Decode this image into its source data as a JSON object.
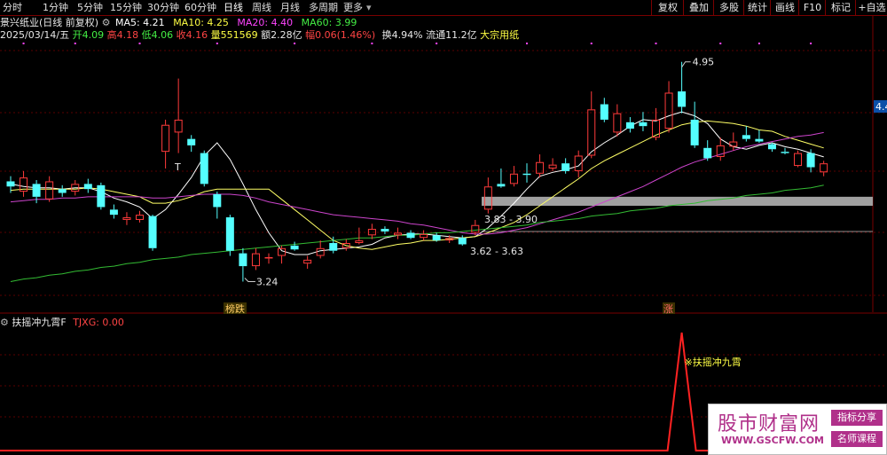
{
  "toolbar": {
    "periods": [
      "分时",
      "1分钟",
      "5分钟",
      "15分钟",
      "30分钟",
      "60分钟",
      "日线",
      "周线",
      "月线",
      "多周期",
      "更多"
    ],
    "active_period": "日线",
    "actions": [
      "复权",
      "叠加",
      "多股",
      "统计",
      "画线",
      "F10",
      "标记",
      "+自选"
    ]
  },
  "info": {
    "stock_title": "景兴纸业(日线 前复权)",
    "ma5_label": "MA5: 4.21",
    "ma10_label": "MA10: 4.25",
    "ma20_label": "MA20: 4.40",
    "ma60_label": "MA60: 3.99",
    "date": "2025/03/14/五",
    "open_label": "开4.09",
    "high_label": "高4.18",
    "low_label": "低4.06",
    "close_label": "收4.16",
    "volume_label": "量551569",
    "amount_label": "额2.28亿",
    "change_label": "幅0.06(1.46%)",
    "turnover_label": "换4.94%",
    "float_label": "流通11.2亿",
    "sector_label": "大宗用纸"
  },
  "chart_data": {
    "type": "candlestick",
    "y_price_range": [
      3.05,
      5.1
    ],
    "annotations": {
      "high": "4.95",
      "low": "3.24",
      "zone_upper": "3.83 - 3.90",
      "zone_lower": "3.62 - 3.63",
      "price_tag": "4.4",
      "badge_down": "榜跌",
      "badge_up": "涨",
      "t_marker": "T"
    },
    "candles": [
      {
        "o": 4.02,
        "c": 3.98,
        "h": 4.06,
        "l": 3.93
      },
      {
        "o": 3.94,
        "c": 4.05,
        "h": 4.1,
        "l": 3.9
      },
      {
        "o": 4.0,
        "c": 3.9,
        "h": 4.03,
        "l": 3.85
      },
      {
        "o": 3.88,
        "c": 4.02,
        "h": 4.06,
        "l": 3.86
      },
      {
        "o": 3.96,
        "c": 3.93,
        "h": 3.99,
        "l": 3.9
      },
      {
        "o": 3.94,
        "c": 4.0,
        "h": 4.03,
        "l": 3.91
      },
      {
        "o": 4.0,
        "c": 3.96,
        "h": 4.04,
        "l": 3.93
      },
      {
        "o": 3.99,
        "c": 3.82,
        "h": 4.01,
        "l": 3.8
      },
      {
        "o": 3.8,
        "c": 3.76,
        "h": 3.84,
        "l": 3.73
      },
      {
        "o": 3.72,
        "c": 3.74,
        "h": 3.78,
        "l": 3.68
      },
      {
        "o": 3.72,
        "c": 3.76,
        "h": 3.79,
        "l": 3.7
      },
      {
        "o": 3.75,
        "c": 3.5,
        "h": 3.76,
        "l": 3.48
      },
      {
        "o": 4.25,
        "c": 4.46,
        "h": 4.5,
        "l": 4.12
      },
      {
        "o": 4.4,
        "c": 4.5,
        "h": 4.82,
        "l": 4.24
      },
      {
        "o": 4.35,
        "c": 4.3,
        "h": 4.38,
        "l": 4.25
      },
      {
        "o": 4.24,
        "c": 4.0,
        "h": 4.26,
        "l": 3.98
      },
      {
        "o": 3.92,
        "c": 3.82,
        "h": 3.94,
        "l": 3.73
      },
      {
        "o": 3.74,
        "c": 3.48,
        "h": 3.76,
        "l": 3.44
      },
      {
        "o": 3.46,
        "c": 3.36,
        "h": 3.5,
        "l": 3.24
      },
      {
        "o": 3.36,
        "c": 3.46,
        "h": 3.5,
        "l": 3.33
      },
      {
        "o": 3.42,
        "c": 3.43,
        "h": 3.46,
        "l": 3.38
      },
      {
        "o": 3.44,
        "c": 3.5,
        "h": 3.52,
        "l": 3.38
      },
      {
        "o": 3.52,
        "c": 3.49,
        "h": 3.55,
        "l": 3.48
      },
      {
        "o": 3.38,
        "c": 3.41,
        "h": 3.44,
        "l": 3.34
      },
      {
        "o": 3.44,
        "c": 3.5,
        "h": 3.56,
        "l": 3.42
      },
      {
        "o": 3.54,
        "c": 3.48,
        "h": 3.59,
        "l": 3.46
      },
      {
        "o": 3.5,
        "c": 3.54,
        "h": 3.57,
        "l": 3.48
      },
      {
        "o": 3.54,
        "c": 3.56,
        "h": 3.66,
        "l": 3.53
      },
      {
        "o": 3.6,
        "c": 3.65,
        "h": 3.69,
        "l": 3.57
      },
      {
        "o": 3.65,
        "c": 3.63,
        "h": 3.67,
        "l": 3.61
      },
      {
        "o": 3.6,
        "c": 3.62,
        "h": 3.66,
        "l": 3.57
      },
      {
        "o": 3.62,
        "c": 3.58,
        "h": 3.64,
        "l": 3.57
      },
      {
        "o": 3.58,
        "c": 3.61,
        "h": 3.64,
        "l": 3.56
      },
      {
        "o": 3.6,
        "c": 3.56,
        "h": 3.62,
        "l": 3.55
      },
      {
        "o": 3.56,
        "c": 3.58,
        "h": 3.6,
        "l": 3.54
      },
      {
        "o": 3.58,
        "c": 3.53,
        "h": 3.6,
        "l": 3.52
      },
      {
        "o": 3.62,
        "c": 3.68,
        "h": 3.72,
        "l": 3.6
      },
      {
        "o": 3.8,
        "c": 3.98,
        "h": 4.05,
        "l": 3.77
      },
      {
        "o": 4.0,
        "c": 3.98,
        "h": 4.12,
        "l": 3.97
      },
      {
        "o": 4.0,
        "c": 4.08,
        "h": 4.14,
        "l": 3.98
      },
      {
        "o": 4.08,
        "c": 4.07,
        "h": 4.16,
        "l": 4.01
      },
      {
        "o": 4.08,
        "c": 4.17,
        "h": 4.23,
        "l": 4.05
      },
      {
        "o": 4.12,
        "c": 4.15,
        "h": 4.2,
        "l": 4.1
      },
      {
        "o": 4.16,
        "c": 4.1,
        "h": 4.2,
        "l": 4.08
      },
      {
        "o": 4.1,
        "c": 4.22,
        "h": 4.26,
        "l": 4.05
      },
      {
        "o": 4.22,
        "c": 4.58,
        "h": 4.72,
        "l": 4.2
      },
      {
        "o": 4.62,
        "c": 4.5,
        "h": 4.67,
        "l": 4.48
      },
      {
        "o": 4.4,
        "c": 4.55,
        "h": 4.62,
        "l": 4.37
      },
      {
        "o": 4.48,
        "c": 4.43,
        "h": 4.52,
        "l": 4.4
      },
      {
        "o": 4.48,
        "c": 4.45,
        "h": 4.56,
        "l": 4.41
      },
      {
        "o": 4.36,
        "c": 4.5,
        "h": 4.59,
        "l": 4.34
      },
      {
        "o": 4.43,
        "c": 4.71,
        "h": 4.8,
        "l": 4.4
      },
      {
        "o": 4.72,
        "c": 4.6,
        "h": 4.95,
        "l": 4.55
      },
      {
        "o": 4.5,
        "c": 4.3,
        "h": 4.64,
        "l": 4.28
      },
      {
        "o": 4.28,
        "c": 4.2,
        "h": 4.34,
        "l": 4.18
      },
      {
        "o": 4.21,
        "c": 4.3,
        "h": 4.36,
        "l": 4.18
      },
      {
        "o": 4.29,
        "c": 4.33,
        "h": 4.4,
        "l": 4.26
      },
      {
        "o": 4.38,
        "c": 4.35,
        "h": 4.45,
        "l": 4.33
      },
      {
        "o": 4.35,
        "c": 4.33,
        "h": 4.42,
        "l": 4.32
      },
      {
        "o": 4.31,
        "c": 4.27,
        "h": 4.32,
        "l": 4.25
      },
      {
        "o": 4.25,
        "c": 4.24,
        "h": 4.28,
        "l": 4.23
      },
      {
        "o": 4.14,
        "c": 4.24,
        "h": 4.26,
        "l": 4.13
      },
      {
        "o": 4.24,
        "c": 4.13,
        "h": 4.27,
        "l": 4.09
      },
      {
        "o": 4.09,
        "c": 4.16,
        "h": 4.18,
        "l": 4.06
      }
    ],
    "series": [
      {
        "name": "MA5",
        "color": "#ffffff",
        "values": [
          4.0,
          3.98,
          3.97,
          3.97,
          3.96,
          3.97,
          3.97,
          3.94,
          3.89,
          3.86,
          3.82,
          3.73,
          3.8,
          3.92,
          4.05,
          4.22,
          4.32,
          4.19,
          4.0,
          3.8,
          3.62,
          3.48,
          3.45,
          3.45,
          3.48,
          3.49,
          3.5,
          3.51,
          3.53,
          3.58,
          3.6,
          3.61,
          3.61,
          3.6,
          3.59,
          3.58,
          3.59,
          3.66,
          3.75,
          3.85,
          3.96,
          4.06,
          4.09,
          4.11,
          4.14,
          4.25,
          4.32,
          4.38,
          4.45,
          4.5,
          4.49,
          4.53,
          4.56,
          4.53,
          4.47,
          4.35,
          4.29,
          4.27,
          4.3,
          4.32,
          4.29,
          4.27,
          4.24,
          4.21
        ]
      },
      {
        "name": "MA10",
        "color": "#ffff66",
        "values": [
          3.95,
          3.96,
          3.96,
          3.96,
          3.96,
          3.96,
          3.97,
          3.96,
          3.94,
          3.92,
          3.9,
          3.85,
          3.85,
          3.87,
          3.9,
          3.94,
          3.96,
          3.96,
          3.96,
          3.96,
          3.96,
          3.88,
          3.8,
          3.72,
          3.64,
          3.56,
          3.52,
          3.5,
          3.49,
          3.51,
          3.53,
          3.54,
          3.56,
          3.56,
          3.57,
          3.58,
          3.59,
          3.62,
          3.66,
          3.7,
          3.76,
          3.83,
          3.9,
          3.97,
          4.04,
          4.12,
          4.18,
          4.23,
          4.28,
          4.33,
          4.38,
          4.42,
          4.46,
          4.48,
          4.49,
          4.48,
          4.47,
          4.45,
          4.42,
          4.41,
          4.37,
          4.34,
          4.31,
          4.28
        ]
      },
      {
        "name": "MA20",
        "color": "#cc44cc",
        "values": [
          3.86,
          3.87,
          3.88,
          3.88,
          3.89,
          3.89,
          3.9,
          3.9,
          3.9,
          3.9,
          3.9,
          3.89,
          3.89,
          3.9,
          3.91,
          3.92,
          3.92,
          3.92,
          3.91,
          3.89,
          3.86,
          3.84,
          3.82,
          3.8,
          3.78,
          3.76,
          3.75,
          3.74,
          3.73,
          3.72,
          3.71,
          3.69,
          3.68,
          3.66,
          3.64,
          3.62,
          3.61,
          3.61,
          3.62,
          3.64,
          3.66,
          3.69,
          3.72,
          3.75,
          3.78,
          3.82,
          3.86,
          3.9,
          3.94,
          3.98,
          4.03,
          4.08,
          4.13,
          4.17,
          4.2,
          4.23,
          4.26,
          4.29,
          4.31,
          4.33,
          4.35,
          4.37,
          4.38,
          4.4
        ]
      },
      {
        "name": "MA60",
        "color": "#33bb33",
        "values": [
          3.24,
          3.26,
          3.27,
          3.29,
          3.3,
          3.32,
          3.33,
          3.35,
          3.36,
          3.38,
          3.39,
          3.41,
          3.42,
          3.43,
          3.45,
          3.46,
          3.47,
          3.48,
          3.49,
          3.5,
          3.51,
          3.52,
          3.53,
          3.54,
          3.55,
          3.56,
          3.57,
          3.58,
          3.58,
          3.59,
          3.6,
          3.6,
          3.61,
          3.62,
          3.62,
          3.63,
          3.64,
          3.65,
          3.66,
          3.67,
          3.68,
          3.7,
          3.71,
          3.72,
          3.73,
          3.75,
          3.76,
          3.77,
          3.79,
          3.8,
          3.81,
          3.83,
          3.84,
          3.85,
          3.87,
          3.88,
          3.89,
          3.91,
          3.92,
          3.93,
          3.95,
          3.96,
          3.97,
          3.99
        ]
      }
    ],
    "zone_band": {
      "top": 3.9,
      "bottom": 3.83
    },
    "ref_line": 3.63
  },
  "indicator": {
    "title": "扶摇冲九霄F",
    "value_label": "TJXG: 0.00",
    "signal_label": "※扶摇冲九霄",
    "signal_candle_index": 52
  },
  "watermark": {
    "name": "股市财富网",
    "url": "WWW.GSCFW.COM",
    "tag1": "指标分享",
    "tag2": "名师课程"
  }
}
